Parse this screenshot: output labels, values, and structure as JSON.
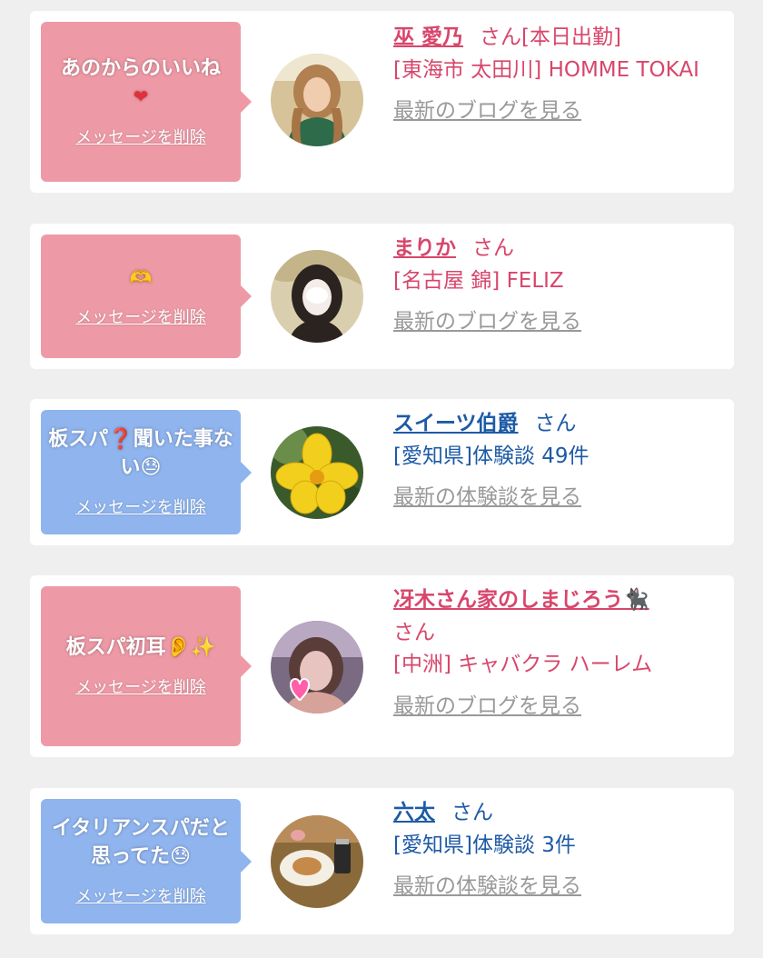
{
  "delete_label": "メッセージを削除",
  "colors": {
    "pink_bubble": "#ee9aa6",
    "blue_bubble": "#8fb4ee",
    "pink_text": "#d8466b",
    "blue_text": "#1d5aa6",
    "link_gray": "#999999"
  },
  "items": [
    {
      "message": "あのからのいいね",
      "message_emoji": "❤",
      "name": "巫 愛乃",
      "honorific": "さん[本日出勤]",
      "detail": "[東海市 太田川] HOMME TOKAI",
      "link": "最新のブログを見る"
    },
    {
      "message": "",
      "message_emoji": "🫶",
      "name": "まりか",
      "honorific": "さん",
      "detail": "[名古屋 錦] FELIZ",
      "link": "最新のブログを見る"
    },
    {
      "message": "板スパ❓聞いた事ない😓",
      "message_emoji": "",
      "name": "スイーツ伯爵",
      "honorific": "さん",
      "detail": "[愛知県]体験談 49件",
      "link": "最新の体験談を見る"
    },
    {
      "message": "板スパ初耳👂✨",
      "message_emoji": "",
      "name": "冴木さん家のしまじろう🐈‍⬛",
      "honorific": "さん",
      "detail": "[中洲] キャバクラ ハーレム",
      "link": "最新のブログを見る"
    },
    {
      "message": "イタリアンスパだと思ってた😓",
      "message_emoji": "",
      "name": "六太",
      "honorific": "さん",
      "detail": "[愛知県]体験談 3件",
      "link": "最新の体験談を見る"
    }
  ]
}
